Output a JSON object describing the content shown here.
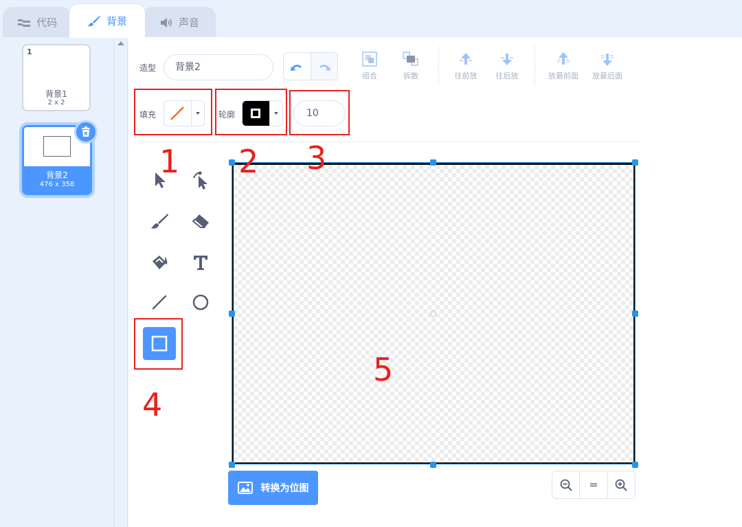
{
  "tabs": {
    "code": "代码",
    "backdrops": "背景",
    "sounds": "声音"
  },
  "costumes": [
    {
      "number": "1",
      "name": "背景1",
      "size": "2 x 2",
      "selected": false
    },
    {
      "number": "2",
      "name": "背景2",
      "size": "476 x 358",
      "selected": true
    }
  ],
  "toolbar": {
    "costume_label": "造型",
    "costume_name": "背景2",
    "group": "组合",
    "ungroup": "拆散",
    "forward": "往前放",
    "backward": "往后放",
    "front": "放最前面",
    "back": "放最后面"
  },
  "style": {
    "fill_label": "填充",
    "outline_label": "轮廓",
    "outline_width": "10",
    "fill_color": "none",
    "outline_color": "#000000"
  },
  "tools": [
    "select-icon",
    "reshape-icon",
    "brush-icon",
    "eraser-icon",
    "fill-icon",
    "text-icon",
    "line-icon",
    "circle-icon",
    "rectangle-icon"
  ],
  "active_tool": "rectangle",
  "annotations": [
    "1",
    "2",
    "3",
    "4",
    "5"
  ],
  "convert_button": "转换为位图",
  "zoom": {
    "zoom_out": "zoom-out-icon",
    "reset": "=",
    "zoom_in": "zoom-in-icon"
  },
  "colors": {
    "accent": "#4c97ff",
    "annotation_red": "#e8201e",
    "selection_blue": "#2a93e6"
  }
}
